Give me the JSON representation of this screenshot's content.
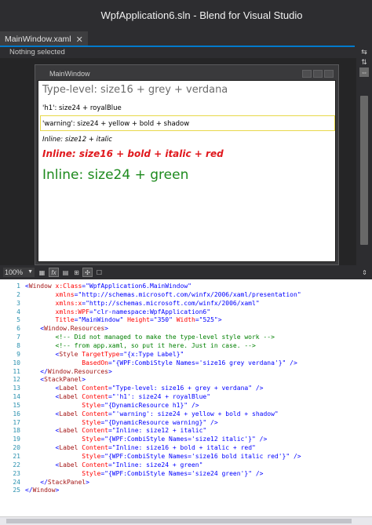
{
  "window": {
    "title": "WpfApplication6.sln - Blend for Visual Studio"
  },
  "doc_tabs": [
    {
      "label": "MainWindow.xaml",
      "close": "✕"
    }
  ],
  "breadcrumb": {
    "text": "Nothing selected"
  },
  "designer": {
    "window_title": "MainWindow",
    "labels": [
      "Type-level: size16 + grey + verdana",
      "'h1': size24 + royalBlue",
      "'warning': size24 + yellow + bold + shadow",
      "Inline: size12 + italic",
      "Inline: size16 + bold + italic + red",
      "Inline: size24 + green"
    ]
  },
  "zoombar": {
    "zoom": "100%",
    "fx_label": "fx"
  },
  "colors": {
    "accent": "#007acc",
    "chrome": "#2d2d30",
    "green": "#1d8a1d",
    "red": "#e0181d"
  },
  "editor": {
    "lines": [
      {
        "n": "1",
        "parts": [
          [
            "b",
            "<"
          ],
          [
            "m",
            "Window"
          ],
          [
            "a",
            " x:Class"
          ],
          [
            "b",
            "=\""
          ],
          [
            "v",
            "WpfApplication6.MainWindow"
          ],
          [
            "b",
            "\""
          ]
        ]
      },
      {
        "n": "2",
        "parts": [
          [
            "a",
            "        xmlns"
          ],
          [
            "b",
            "=\""
          ],
          [
            "v",
            "http://schemas.microsoft.com/winfx/2006/xaml/presentation"
          ],
          [
            "b",
            "\""
          ]
        ]
      },
      {
        "n": "3",
        "parts": [
          [
            "a",
            "        xmlns:x"
          ],
          [
            "b",
            "=\""
          ],
          [
            "v",
            "http://schemas.microsoft.com/winfx/2006/xaml"
          ],
          [
            "b",
            "\""
          ]
        ]
      },
      {
        "n": "4",
        "parts": [
          [
            "a",
            "        xmlns:WPF"
          ],
          [
            "b",
            "=\""
          ],
          [
            "v",
            "clr-namespace:WpfApplication6"
          ],
          [
            "b",
            "\""
          ]
        ]
      },
      {
        "n": "5",
        "parts": [
          [
            "a",
            "        Title"
          ],
          [
            "b",
            "=\""
          ],
          [
            "v",
            "MainWindow"
          ],
          [
            "b",
            "\""
          ],
          [
            "a",
            " Height"
          ],
          [
            "b",
            "=\""
          ],
          [
            "v",
            "350"
          ],
          [
            "b",
            "\""
          ],
          [
            "a",
            " Width"
          ],
          [
            "b",
            "=\""
          ],
          [
            "v",
            "525"
          ],
          [
            "b",
            "\">"
          ]
        ]
      },
      {
        "n": "6",
        "parts": [
          [
            "b",
            "    <"
          ],
          [
            "m",
            "Window.Resources"
          ],
          [
            "b",
            ">"
          ]
        ]
      },
      {
        "n": "7",
        "parts": [
          [
            "c",
            "        <!-- Did not managed to make the type-level style work -->"
          ]
        ]
      },
      {
        "n": "8",
        "parts": [
          [
            "c",
            "        <!-- from app.xaml, so put it here. Just in case. -->"
          ]
        ]
      },
      {
        "n": "9",
        "parts": [
          [
            "b",
            "        <"
          ],
          [
            "m",
            "Style"
          ],
          [
            "a",
            " TargetType"
          ],
          [
            "b",
            "=\""
          ],
          [
            "v",
            "{x:Type Label}"
          ],
          [
            "b",
            "\""
          ]
        ]
      },
      {
        "n": "10",
        "parts": [
          [
            "a",
            "               BasedOn"
          ],
          [
            "b",
            "=\""
          ],
          [
            "v",
            "{WPF:CombiStyle Names='size16 grey verdana'}"
          ],
          [
            "b",
            "\""
          ],
          [
            "b",
            " />"
          ]
        ]
      },
      {
        "n": "11",
        "parts": [
          [
            "b",
            "    </"
          ],
          [
            "m",
            "Window.Resources"
          ],
          [
            "b",
            ">"
          ]
        ]
      },
      {
        "n": "12",
        "parts": [
          [
            "b",
            "    <"
          ],
          [
            "m",
            "StackPanel"
          ],
          [
            "b",
            ">"
          ]
        ]
      },
      {
        "n": "13",
        "parts": [
          [
            "b",
            "        <"
          ],
          [
            "m",
            "Label"
          ],
          [
            "a",
            " Content"
          ],
          [
            "b",
            "=\""
          ],
          [
            "v",
            "Type-level: size16 + grey + verdana"
          ],
          [
            "b",
            "\""
          ],
          [
            "b",
            " />"
          ]
        ]
      },
      {
        "n": "14",
        "parts": [
          [
            "b",
            "        <"
          ],
          [
            "m",
            "Label"
          ],
          [
            "a",
            " Content"
          ],
          [
            "b",
            "=\""
          ],
          [
            "v",
            "'h1': size24 + royalBlue"
          ],
          [
            "b",
            "\""
          ]
        ]
      },
      {
        "n": "15",
        "parts": [
          [
            "a",
            "               Style"
          ],
          [
            "b",
            "=\""
          ],
          [
            "v",
            "{DynamicResource h1}"
          ],
          [
            "b",
            "\""
          ],
          [
            "b",
            " />"
          ]
        ]
      },
      {
        "n": "16",
        "parts": [
          [
            "b",
            "        <"
          ],
          [
            "m",
            "Label"
          ],
          [
            "a",
            " Content"
          ],
          [
            "b",
            "=\""
          ],
          [
            "v",
            "'warning': size24 + yellow + bold + shadow"
          ],
          [
            "b",
            "\""
          ]
        ]
      },
      {
        "n": "17",
        "parts": [
          [
            "a",
            "               Style"
          ],
          [
            "b",
            "=\""
          ],
          [
            "v",
            "{DynamicResource warning}"
          ],
          [
            "b",
            "\""
          ],
          [
            "b",
            " />"
          ]
        ]
      },
      {
        "n": "18",
        "parts": [
          [
            "b",
            "        <"
          ],
          [
            "m",
            "Label"
          ],
          [
            "a",
            " Content"
          ],
          [
            "b",
            "=\""
          ],
          [
            "v",
            "Inline: size12 + italic"
          ],
          [
            "b",
            "\""
          ]
        ]
      },
      {
        "n": "19",
        "parts": [
          [
            "a",
            "               Style"
          ],
          [
            "b",
            "=\""
          ],
          [
            "v",
            "{WPF:CombiStyle Names='size12 italic'}"
          ],
          [
            "b",
            "\""
          ],
          [
            "b",
            " />"
          ]
        ]
      },
      {
        "n": "20",
        "parts": [
          [
            "b",
            "        <"
          ],
          [
            "m",
            "Label"
          ],
          [
            "a",
            " Content"
          ],
          [
            "b",
            "=\""
          ],
          [
            "v",
            "Inline: size16 + bold + italic + red"
          ],
          [
            "b",
            "\""
          ]
        ]
      },
      {
        "n": "21",
        "parts": [
          [
            "a",
            "               Style"
          ],
          [
            "b",
            "=\""
          ],
          [
            "v",
            "{WPF:CombiStyle Names='size16 bold italic red'}"
          ],
          [
            "b",
            "\""
          ],
          [
            "b",
            " />"
          ]
        ]
      },
      {
        "n": "22",
        "parts": [
          [
            "b",
            "        <"
          ],
          [
            "m",
            "Label"
          ],
          [
            "a",
            " Content"
          ],
          [
            "b",
            "=\""
          ],
          [
            "v",
            "Inline: size24 + green"
          ],
          [
            "b",
            "\""
          ]
        ]
      },
      {
        "n": "23",
        "parts": [
          [
            "a",
            "               Style"
          ],
          [
            "b",
            "=\""
          ],
          [
            "v",
            "{WPF:CombiStyle Names='size24 green'}"
          ],
          [
            "b",
            "\""
          ],
          [
            "b",
            " />"
          ]
        ]
      },
      {
        "n": "24",
        "parts": [
          [
            "b",
            "    </"
          ],
          [
            "m",
            "StackPanel"
          ],
          [
            "b",
            ">"
          ]
        ]
      },
      {
        "n": "25",
        "parts": [
          [
            "b",
            "</"
          ],
          [
            "m",
            "Window"
          ],
          [
            "b",
            ">"
          ]
        ]
      }
    ]
  }
}
